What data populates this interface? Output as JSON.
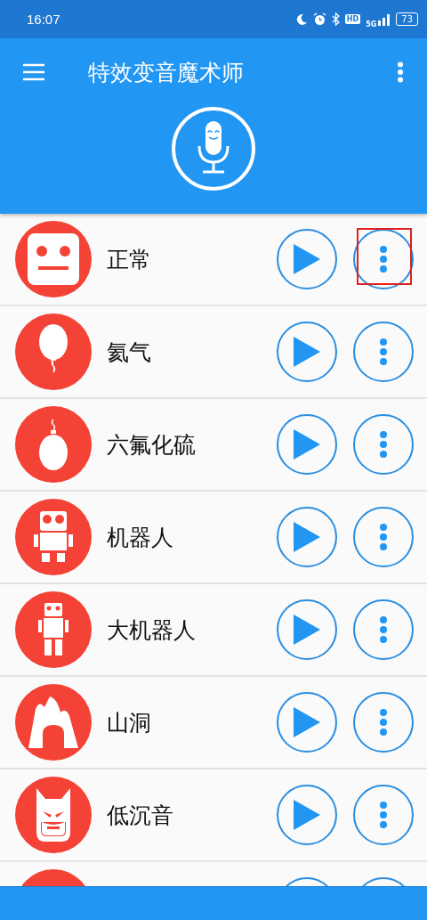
{
  "status_bar": {
    "time": "16:07",
    "hd_badge": "HD",
    "network": "5G",
    "battery": "73"
  },
  "app_bar": {
    "title": "特效变音魔术师"
  },
  "effects": [
    {
      "name": "正常",
      "kind": "face",
      "highlighted": true
    },
    {
      "name": "氦气",
      "kind": "balloon",
      "highlighted": false
    },
    {
      "name": "六氟化硫",
      "kind": "weight",
      "highlighted": false
    },
    {
      "name": "机器人",
      "kind": "robot",
      "highlighted": false
    },
    {
      "name": "大机器人",
      "kind": "giant",
      "highlighted": false
    },
    {
      "name": "山洞",
      "kind": "cave",
      "highlighted": false
    },
    {
      "name": "低沉音",
      "kind": "mask",
      "highlighted": false
    },
    {
      "kind": "partial",
      "highlighted": false
    }
  ]
}
